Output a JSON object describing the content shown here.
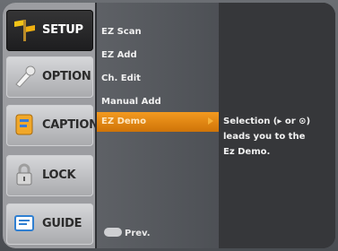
{
  "nav": {
    "items": [
      {
        "label": "SETUP",
        "icon": "setup-icon"
      },
      {
        "label": "OPTION",
        "icon": "option-icon"
      },
      {
        "label": "CAPTION",
        "icon": "caption-icon"
      },
      {
        "label": "LOCK",
        "icon": "lock-icon"
      },
      {
        "label": "GUIDE",
        "icon": "guide-icon"
      }
    ],
    "active_index": 0
  },
  "menu": {
    "items": [
      {
        "label": "EZ Scan"
      },
      {
        "label": "EZ Add"
      },
      {
        "label": "Ch. Edit"
      },
      {
        "label": "Manual Add"
      },
      {
        "label": "EZ Demo"
      }
    ],
    "selected_index": 4,
    "prev_label": "Prev."
  },
  "description": {
    "lines": [
      "Selection (▸ or ⊙)",
      "leads you to the",
      "Ez Demo."
    ]
  },
  "colors": {
    "accent": "#e0841a",
    "active_nav": "#1f1f20"
  }
}
